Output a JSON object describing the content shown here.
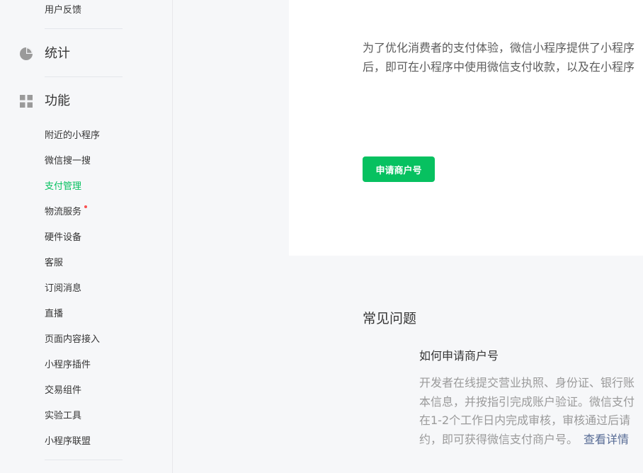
{
  "sidebar": {
    "feedback_label": "用户反馈",
    "stats": {
      "title": "统计",
      "icon": "pie-chart-icon"
    },
    "features": {
      "title": "功能",
      "icon": "grid-icon",
      "items": [
        {
          "label": "附近的小程序"
        },
        {
          "label": "微信搜一搜"
        },
        {
          "label": "支付管理",
          "active": true
        },
        {
          "label": "物流服务",
          "new_dot": true
        },
        {
          "label": "硬件设备"
        },
        {
          "label": "客服"
        },
        {
          "label": "订阅消息"
        },
        {
          "label": "直播"
        },
        {
          "label": "页面内容接入"
        },
        {
          "label": "小程序插件"
        },
        {
          "label": "交易组件"
        },
        {
          "label": "实验工具"
        },
        {
          "label": "小程序联盟"
        }
      ]
    },
    "accent_color": "#07c160"
  },
  "main": {
    "description_line1": "为了优化消费者的支付体验，微信小程序提供了小程序",
    "description_line2": "后，即可在小程序中使用微信支付收款，以及在小程序",
    "apply_button": "申请商户号"
  },
  "faq": {
    "title": "常见问题",
    "question": "如何申请商户号",
    "answer_lines": [
      "开发者在线提交营业执照、身份证、银行账",
      "本信息，并按指引完成账户验证。微信支付",
      "在1-2个工作日内完成审核，审核通过后请",
      "约，即可获得微信支付商户号。"
    ],
    "details_link": "查看详情"
  }
}
